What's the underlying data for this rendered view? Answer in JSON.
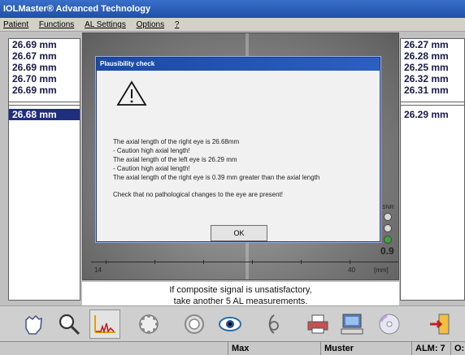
{
  "window": {
    "title": "IOLMaster® Advanced Technology"
  },
  "menu": [
    "Patient",
    "Functions",
    "AL Settings",
    "Options",
    "?"
  ],
  "left_panel": {
    "measurements": [
      "26.69 mm",
      "26.67 mm",
      "26.69 mm",
      "26.70 mm",
      "26.69 mm"
    ],
    "average": "26.68 mm"
  },
  "right_panel": {
    "measurements": [
      "26.27 mm",
      "26.28 mm",
      "26.25 mm",
      "26.32 mm",
      "26.31 mm"
    ],
    "average": "26.29 mm"
  },
  "graph": {
    "axis_min_label": "14",
    "axis_max_label": "40",
    "axis_unit": "[mm]",
    "snr_label": "SNR",
    "zoom_value": "0.9"
  },
  "dialog": {
    "title": "Plausibility check",
    "lines": [
      "The axial length of the right eye is 26.68mm",
      "- Caution high axial length!",
      "The axial length of the left eye is 26.29 mm",
      "- Caution high axial length!",
      "The axial length of the right eye is 0.39 mm greater than the axial length"
    ],
    "check": "Check that no pathological changes to the eye are present!",
    "ok": "OK"
  },
  "hint": {
    "line1": "If composite signal is unsatisfactory,",
    "line2": "take another 5 AL measurements."
  },
  "toolbar": {
    "icons": [
      "hand-icon",
      "magnifier-icon",
      "signal-graph-icon",
      "keratometry-icon",
      "ring-icon",
      "eye-icon",
      "lens-icon",
      "printer-icon",
      "computer-icon",
      "disc-icon",
      "exit-door-icon"
    ]
  },
  "status": {
    "patient": "Max",
    "name": "Muster",
    "alm": "ALM: 7",
    "trailing": "O:"
  }
}
